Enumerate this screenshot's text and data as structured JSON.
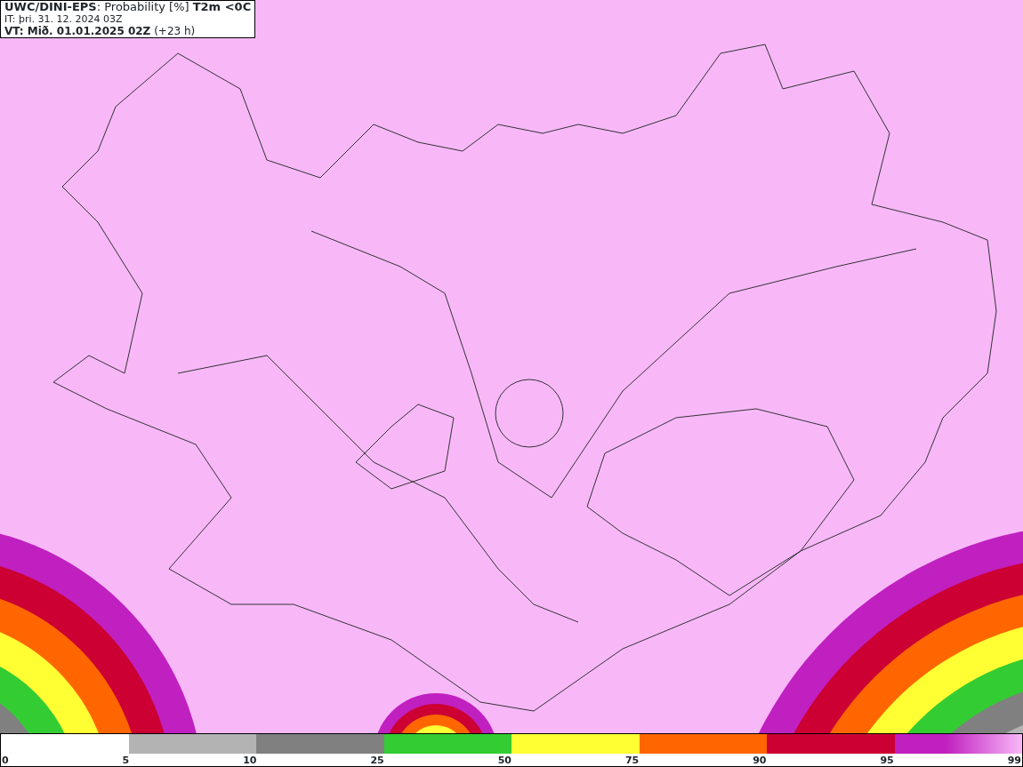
{
  "header": {
    "title": "**UWC/DINI-EPS**: Probability [%] **T2m <0C**",
    "issue_time": "IT: þri. 31. 12. 2024 03Z",
    "valid_time": "**VT: Mið. 01.01.2025 02Z** (+23 h)"
  },
  "legend": {
    "segments": [
      {
        "color": "#ffffff"
      },
      {
        "color": "#b3b3b3"
      },
      {
        "color": "#808080"
      },
      {
        "color": "#33cc33"
      },
      {
        "color": "#ffff33"
      },
      {
        "color": "#ff6600"
      },
      {
        "color": "#cc0033"
      },
      {
        "color": "#c020c0"
      }
    ],
    "ticks": [
      "0",
      "5",
      "10",
      "25",
      "50",
      "75",
      "90",
      "95",
      "99"
    ]
  }
}
